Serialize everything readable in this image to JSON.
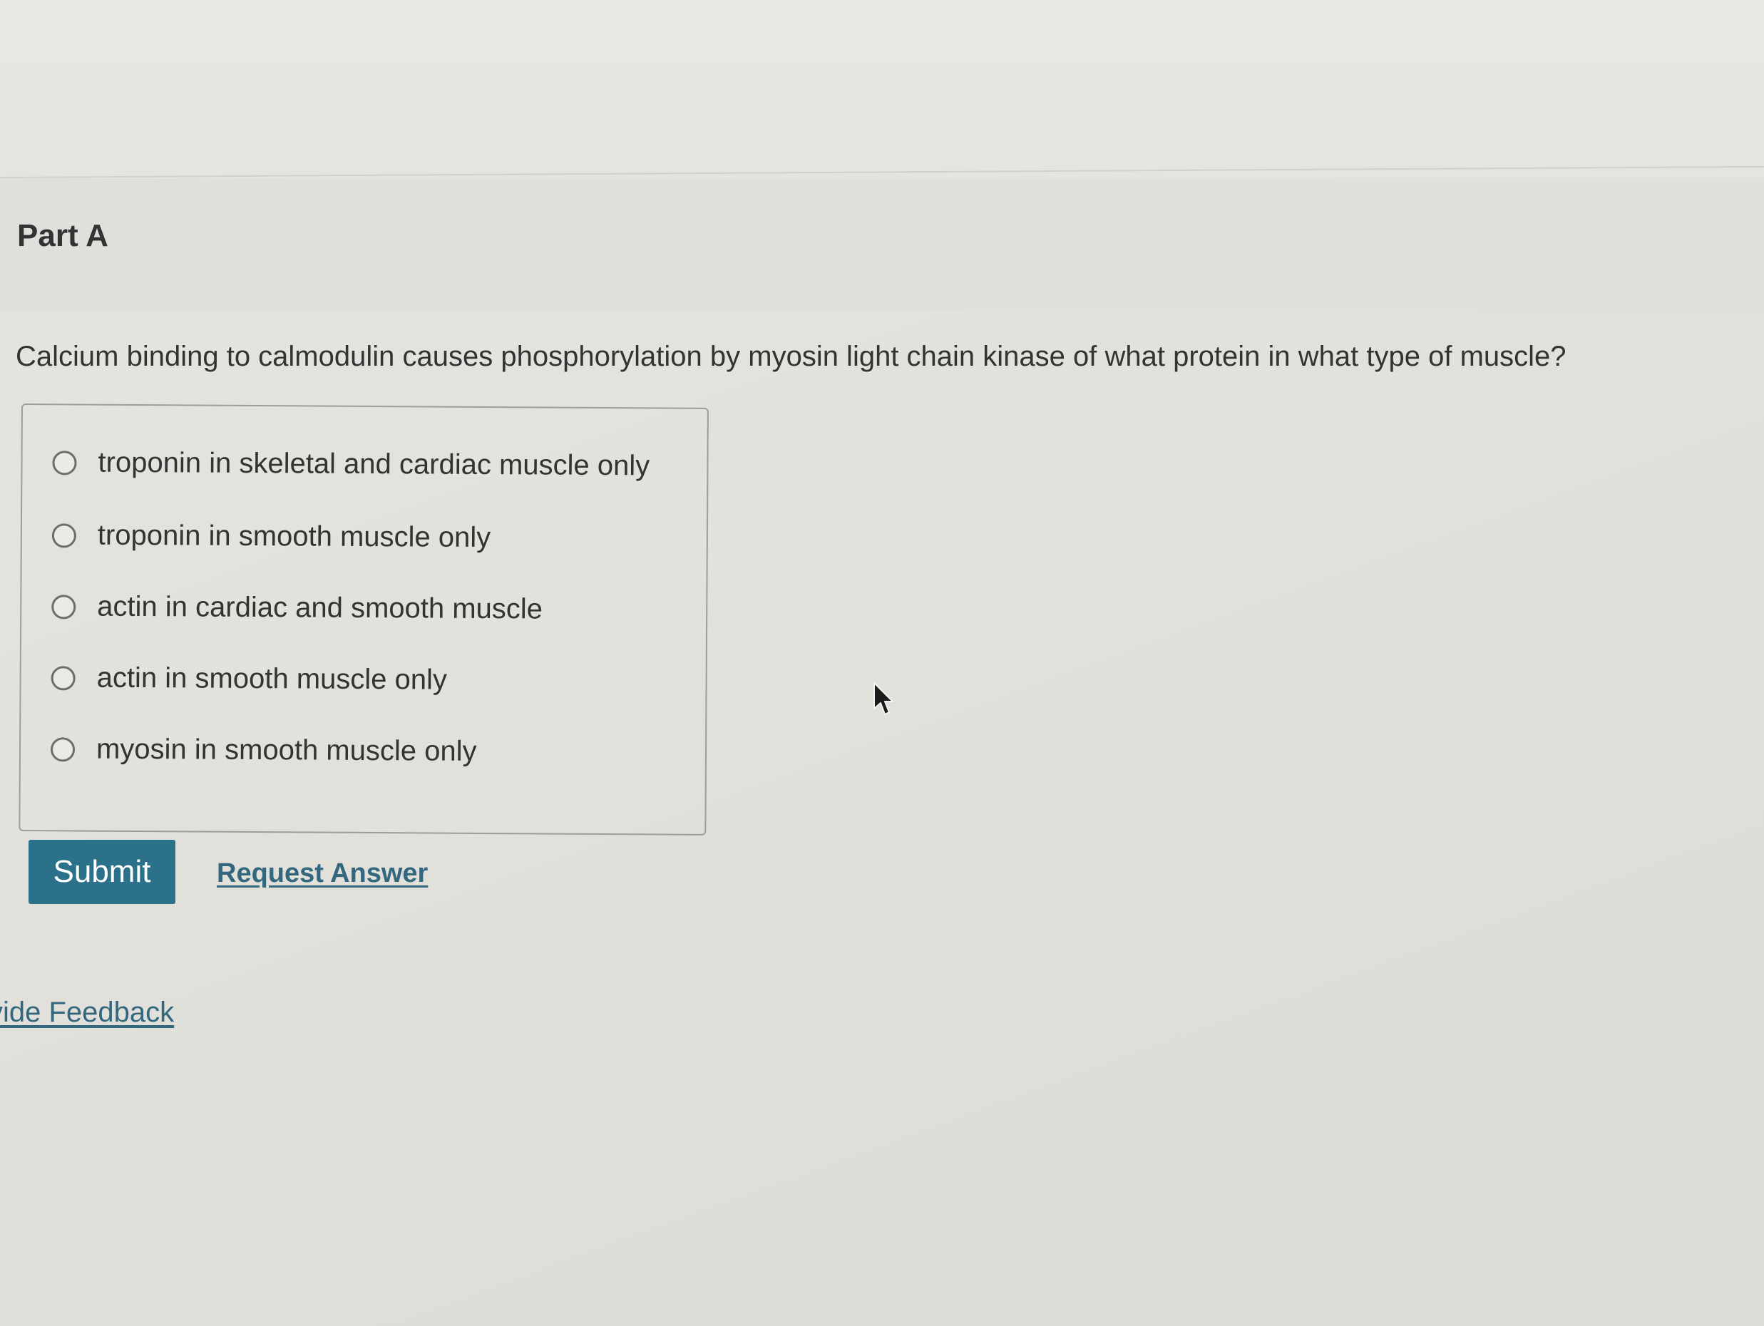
{
  "part": {
    "title": "Part A"
  },
  "question": {
    "text": "Calcium binding to calmodulin causes phosphorylation by myosin light chain kinase of what protein in what type of muscle?"
  },
  "options": [
    {
      "label": "troponin in skeletal and cardiac muscle only",
      "selected": false
    },
    {
      "label": "troponin in smooth muscle only",
      "selected": false
    },
    {
      "label": "actin in cardiac and smooth muscle",
      "selected": false
    },
    {
      "label": "actin in smooth muscle only",
      "selected": false
    },
    {
      "label": "myosin in smooth muscle only",
      "selected": false
    }
  ],
  "actions": {
    "submit_label": "Submit",
    "request_answer_label": "Request Answer"
  },
  "footer": {
    "feedback_label": "vide Feedback"
  },
  "colors": {
    "submit_bg": "#2b7189",
    "link": "#33677e",
    "background": "#e2e1dc"
  },
  "icons": {
    "cursor": "mouse-pointer-icon",
    "radio": "radio-unselected-icon"
  }
}
